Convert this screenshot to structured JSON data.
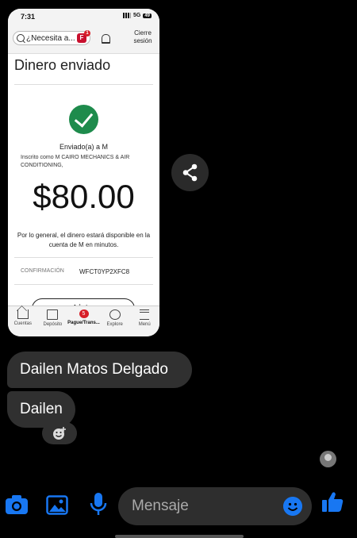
{
  "screenshot": {
    "status": {
      "time": "7:31",
      "network": "5G",
      "battery": "49"
    },
    "search": {
      "placeholder": "¿Necesita a...",
      "badge": "1"
    },
    "signout_label": "Cierre sesión",
    "heading": "Dinero enviado",
    "sent_to": "Enviado(a) a M",
    "enrolled_as": "Inscrito como M CAIRO MECHANICS & AIR CONDITIONING,",
    "amount": "$80.00",
    "availability": "Por lo general, el dinero estará disponible en la cuenta de M en minutos.",
    "confirmation_label": "CONFIRMACIÓN",
    "confirmation_value": "WFCT0YP2XFC8",
    "done_label": "Listo",
    "tabs": [
      {
        "label": "Cuentas",
        "icon": "home-icon"
      },
      {
        "label": "Depósito",
        "icon": "deposit-icon"
      },
      {
        "label": "Pague/Trans...",
        "icon": "pay-icon",
        "badge": "5",
        "active": true
      },
      {
        "label": "Explore",
        "icon": "compass-icon"
      },
      {
        "label": "Menú",
        "icon": "menu-icon"
      }
    ]
  },
  "messages": [
    {
      "text": "Dailen Matos Delgado"
    },
    {
      "text": "Dailen"
    }
  ],
  "composer": {
    "placeholder": "Mensaje"
  },
  "colors": {
    "accent": "#1877f2",
    "bubble": "#303030",
    "check": "#1e8b4c"
  }
}
